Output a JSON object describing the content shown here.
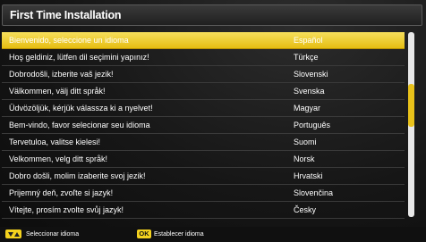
{
  "title": "First Time Installation",
  "languages": [
    {
      "phrase": "Bienvenido, seleccione un idioma",
      "language": "Español",
      "selected": true
    },
    {
      "phrase": "Hoş geldiniz, lütfen dil seçimini yapınız!",
      "language": "Türkçe",
      "selected": false
    },
    {
      "phrase": "Dobrodošli, izberite vaš jezik!",
      "language": "Slovenski",
      "selected": false
    },
    {
      "phrase": "Välkommen, välj ditt språk!",
      "language": "Svenska",
      "selected": false
    },
    {
      "phrase": "Üdvözöljük, kérjük válassza ki a nyelvet!",
      "language": "Magyar",
      "selected": false
    },
    {
      "phrase": "Bem-vindo, favor selecionar seu idioma",
      "language": "Português",
      "selected": false
    },
    {
      "phrase": "Tervetuloa, valitse kielesi!",
      "language": "Suomi",
      "selected": false
    },
    {
      "phrase": "Velkommen, velg ditt språk!",
      "language": "Norsk",
      "selected": false
    },
    {
      "phrase": "Dobro došli, molim izaberite svoj jezik!",
      "language": "Hrvatski",
      "selected": false
    },
    {
      "phrase": "Prijemný deň, zvoľte si jazyk!",
      "language": "Slovenčina",
      "selected": false
    },
    {
      "phrase": "Vítejte, prosím zvolte svůj jazyk!",
      "language": "Česky",
      "selected": false
    }
  ],
  "scroll": {
    "position_fraction": 0.28,
    "visible_fraction": 0.23
  },
  "footer": {
    "select_label": "Seleccionar idioma",
    "ok_badge": "OK",
    "confirm_label": "Establecer idioma"
  },
  "colors": {
    "highlight": "#f0cc2a",
    "button_badge": "#f4d21e",
    "scroll_thumb": "#e9c21a"
  },
  "icons": {
    "select_keys": "up-down-arrows-icon"
  }
}
